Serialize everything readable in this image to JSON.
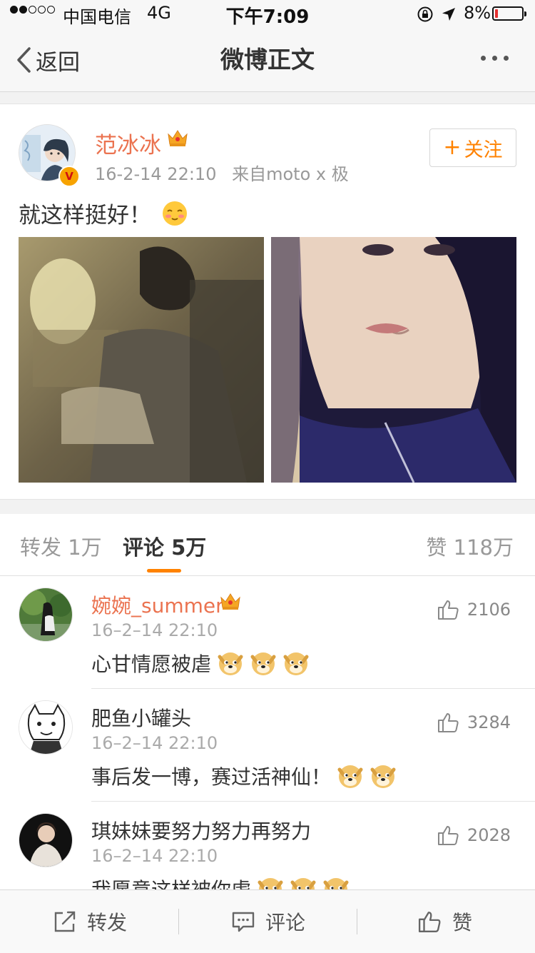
{
  "status_bar": {
    "carrier": "中国电信",
    "network": "4G",
    "time": "下午7:09",
    "battery": "8%"
  },
  "nav": {
    "back_label": "返回",
    "title": "微博正文"
  },
  "post": {
    "author": "范冰冰",
    "time": "16-2-14 22:10",
    "source": "来自moto x 极",
    "follow_label": "关注",
    "text": "就这样挺好！",
    "emoji": "shy-face-emoji"
  },
  "stats": {
    "repost": "转发 1万",
    "comments": "评论 5万",
    "likes": "赞 118万"
  },
  "comments": [
    {
      "user": "婉婉_summer",
      "time": "16–2–14 22:10",
      "text": "心甘情愿被虐",
      "likes": "2106",
      "emoji_count": 3
    },
    {
      "user": "肥鱼小罐头",
      "time": "16–2–14 22:10",
      "text": "事后发一博，赛过活神仙！",
      "likes": "3284",
      "emoji_count": 2
    },
    {
      "user": "琪妹妹要努力努力再努力",
      "time": "16–2–14 22:10",
      "text": "我愿意这样被你虐",
      "likes": "2028",
      "emoji_count": 3
    }
  ],
  "toolbar": {
    "repost": "转发",
    "comment": "评论",
    "like": "赞"
  },
  "colors": {
    "accent": "#ff8200",
    "username": "#eb7350"
  }
}
